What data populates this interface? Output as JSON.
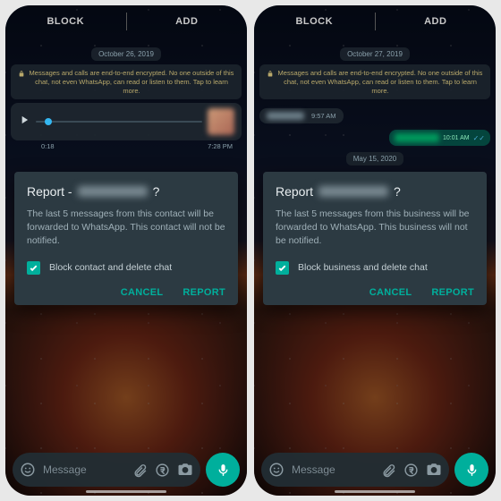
{
  "left": {
    "topbar": {
      "block": "BLOCK",
      "add": "ADD"
    },
    "date1": "October 26, 2019",
    "encryption": "Messages and calls are end-to-end encrypted. No one outside of this chat, not even WhatsApp, can read or listen to them. Tap to learn more.",
    "audio": {
      "elapsed": "0:18",
      "timestamp": "7:28 PM"
    },
    "modal": {
      "title_prefix": "Report - ",
      "title_suffix": "?",
      "body": "The last 5 messages from this contact will be forwarded to WhatsApp. This contact will not be notified.",
      "checkbox_label": "Block contact and delete chat",
      "cancel": "CANCEL",
      "report": "REPORT"
    },
    "input_placeholder": "Message"
  },
  "right": {
    "topbar": {
      "block": "BLOCK",
      "add": "ADD"
    },
    "date1": "October 27, 2019",
    "encryption": "Messages and calls are end-to-end encrypted. No one outside of this chat, not even WhatsApp, can read or listen to them. Tap to learn more.",
    "in_time": "9:57 AM",
    "out_time": "10:01 AM",
    "date2": "May 15, 2020",
    "modal": {
      "title_prefix": "Report ",
      "title_suffix": "?",
      "body": "The last 5 messages from this business will be forwarded to WhatsApp. This business will not be notified.",
      "checkbox_label": "Block business and delete chat",
      "cancel": "CANCEL",
      "report": "REPORT"
    },
    "input_placeholder": "Message"
  },
  "colors": {
    "accent": "#00af9c"
  }
}
